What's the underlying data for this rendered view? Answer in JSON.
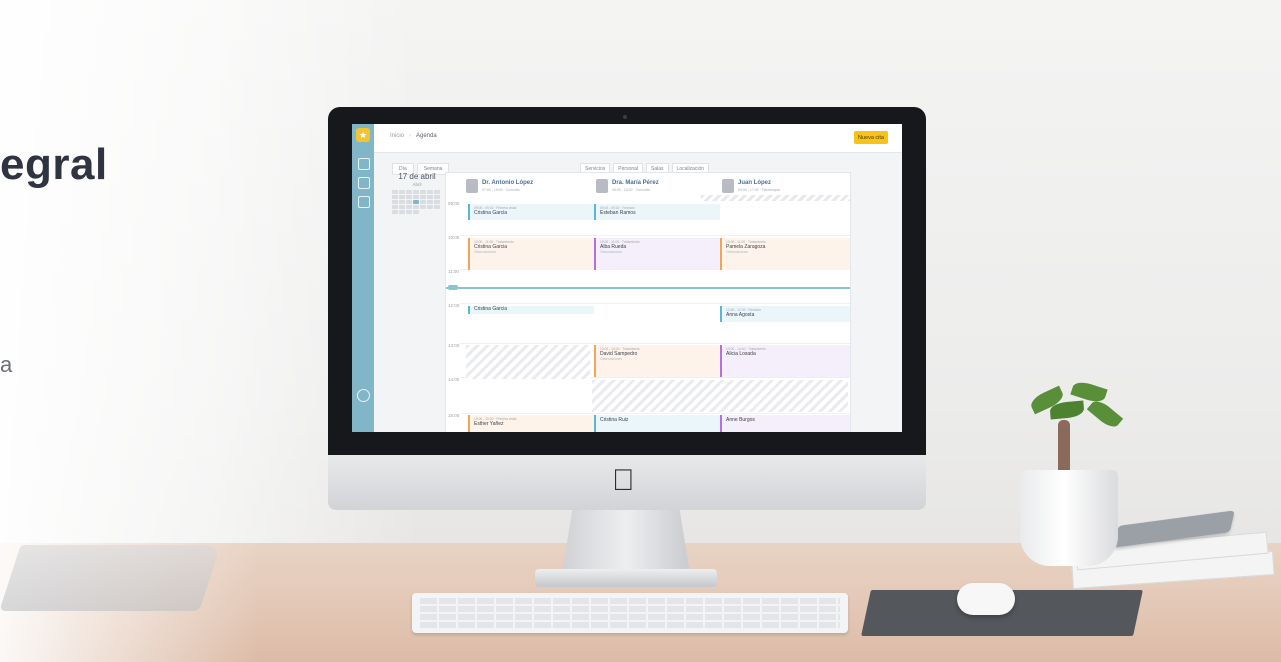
{
  "hero": {
    "headline": "egral",
    "subtext": "a"
  },
  "app": {
    "breadcrumb_home": "Inicio",
    "breadcrumb_current": "Agenda",
    "new_appointment_button": "Nueva cita",
    "view_tabs": [
      "Día",
      "Semana"
    ],
    "filters": [
      "Servicios",
      "Personal",
      "Salas",
      "Localización"
    ],
    "mini_calendar": {
      "date": "17 de abril",
      "month": "Abril"
    },
    "doctors": [
      {
        "name": "Dr. Antonio López",
        "sub": "07:00 - 15:00 · Consulta"
      },
      {
        "name": "Dra. María Pérez",
        "sub": "08:00 - 16:00 · Consulta"
      },
      {
        "name": "Juan López",
        "sub": "09:00 - 17:00 · Fisioterapia"
      }
    ],
    "times": [
      "09:00",
      "10:00",
      "11:00",
      "12:00",
      "13:00",
      "14:00",
      "15:00"
    ],
    "current_time": "11:30",
    "appointments": [
      {
        "name": "Cristina Garcia",
        "meta": "09:00 - 09:30 · Primera visita",
        "note": ""
      },
      {
        "name": "Esteban Ramos",
        "meta": "09:00 - 09:30 · Revisión",
        "note": ""
      },
      {
        "name": "Cristina Garcia",
        "meta": "10:00 - 11:00 · Tratamiento",
        "note": "Observaciones"
      },
      {
        "name": "Alba Rueda",
        "meta": "10:00 - 11:00 · Tratamiento",
        "note": "Observaciones"
      },
      {
        "name": "Pamela Zaragoza",
        "meta": "10:00 - 11:00 · Tratamiento",
        "note": "Observaciones"
      },
      {
        "name": "Cristina Garcia",
        "meta": "",
        "note": ""
      },
      {
        "name": "Anna Agosta",
        "meta": "12:00 - 12:30 · Revisión",
        "note": ""
      },
      {
        "name": "David Sampedro",
        "meta": "13:00 - 14:00 · Tratamiento",
        "note": "Observaciones"
      },
      {
        "name": "Alicia Losada",
        "meta": "13:00 - 14:00 · Tratamiento",
        "note": ""
      },
      {
        "name": "Esther Yañez",
        "meta": "15:00 - 15:30 · Primera visita",
        "note": ""
      },
      {
        "name": "Cristina Ruiz",
        "meta": "",
        "note": ""
      },
      {
        "name": "Anne Burgos",
        "meta": "",
        "note": ""
      }
    ]
  }
}
